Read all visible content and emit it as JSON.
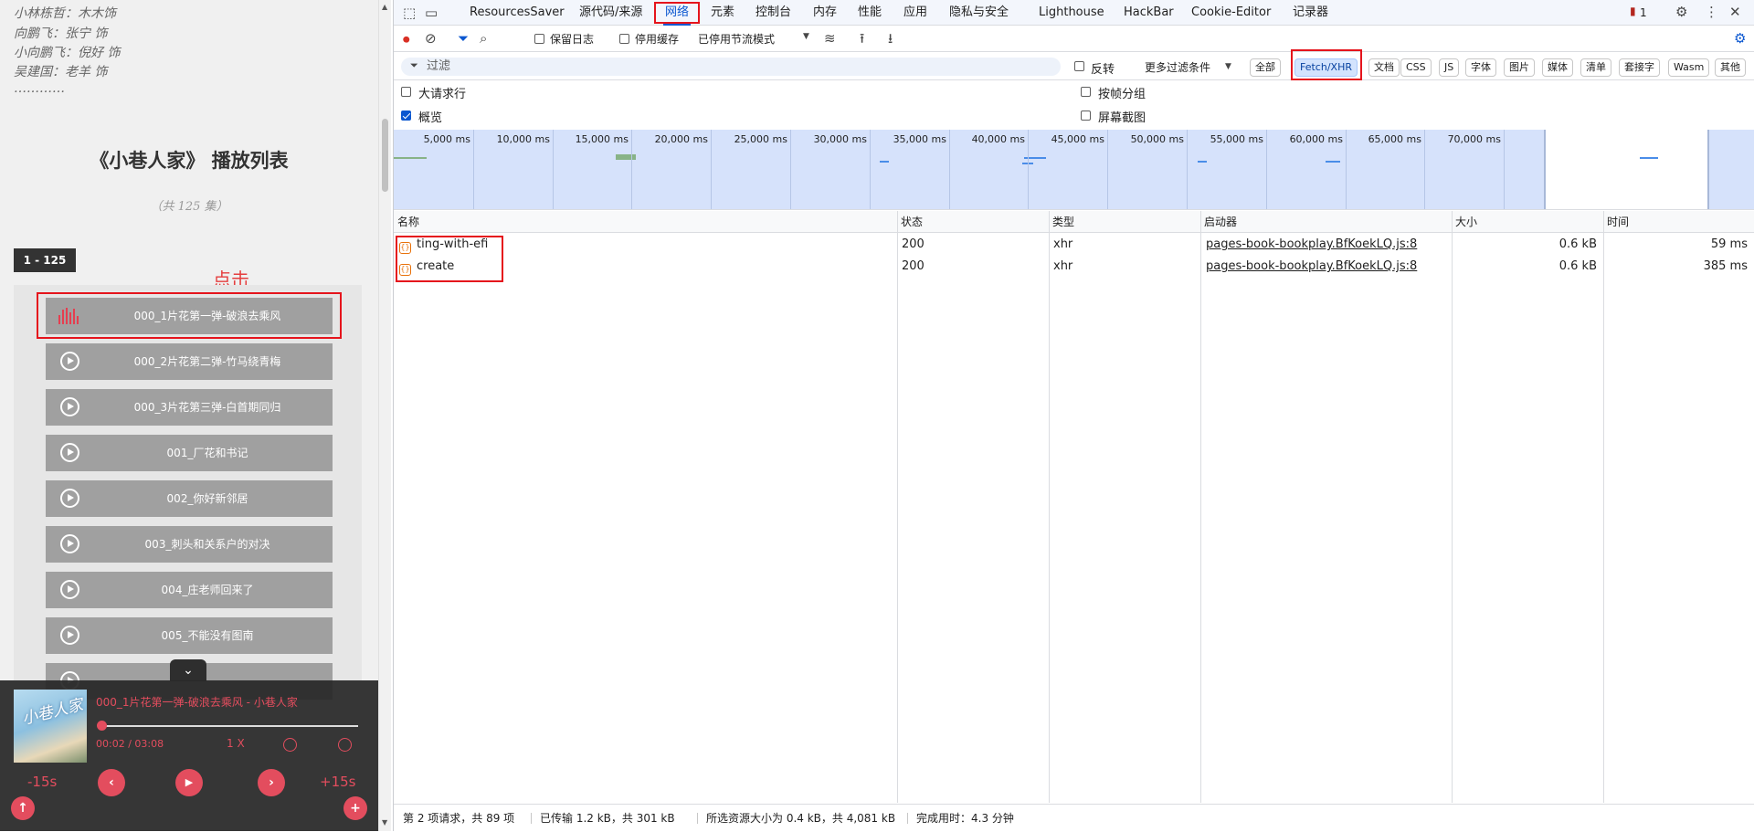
{
  "page": {
    "cast": [
      "小林栋哲：木木饰",
      "向鹏飞：张宁 饰",
      "小向鹏飞：倪好 饰",
      "吴建国：老羊 饰",
      "…………"
    ],
    "playlist_title": "《小巷人家》  播放列表",
    "episode_count": "（共 125 集）",
    "range_tab": "1 - 125",
    "click_hint": "点击",
    "episodes": [
      "000_1片花第一弹-破浪去乘风",
      "000_2片花第二弹-竹马绕青梅",
      "000_3片花第三弹-白首期同归",
      "001_厂花和书记",
      "002_你好新邻居",
      "003_刺头和关系户的对决",
      "004_庄老师回来了",
      "005_不能没有图南"
    ],
    "player": {
      "cover_text": "小巷人家",
      "now_playing": "000_1片花第一弹-破浪去乘风 - 小巷人家",
      "time": "00:02 / 03:08",
      "speed": "1 X",
      "progress_fraction": 0.01,
      "rewind": "-15s",
      "forward": "+15s"
    }
  },
  "devtools": {
    "tabs": [
      "ResourcesSaver",
      "源代码/来源",
      "网络",
      "元素",
      "控制台",
      "内存",
      "性能",
      "应用",
      "隐私与安全",
      "Lighthouse",
      "HackBar",
      "Cookie-Editor",
      "记录器"
    ],
    "active_tab": "网络",
    "issues_count": "1",
    "toolbar": {
      "preserve_log": "保留日志",
      "disable_cache": "停用缓存",
      "throttle": "已停用节流模式"
    },
    "filter": {
      "placeholder": "过滤",
      "invert": "反转",
      "more_filters": "更多过滤条件",
      "chips": [
        "全部",
        "Fetch/XHR",
        "文档",
        "CSS",
        "JS",
        "字体",
        "图片",
        "媒体",
        "清单",
        "套接字",
        "Wasm",
        "其他"
      ],
      "selected_chip": "Fetch/XHR"
    },
    "options": {
      "big_rows": "大请求行",
      "overview": "概览",
      "group_by_frame": "按帧分组",
      "screenshots": "屏幕截图"
    },
    "overview_ticks": [
      "5,000 ms",
      "10,000 ms",
      "15,000 ms",
      "20,000 ms",
      "25,000 ms",
      "30,000 ms",
      "35,000 ms",
      "40,000 ms",
      "45,000 ms",
      "50,000 ms",
      "55,000 ms",
      "60,000 ms",
      "65,000 ms",
      "70,000 ms"
    ],
    "columns": [
      "名称",
      "状态",
      "类型",
      "启动器",
      "大小",
      "时间"
    ],
    "requests": [
      {
        "name": "ting-with-efi",
        "status": "200",
        "type": "xhr",
        "initiator": "pages-book-bookplay.BfKoekLQ.js:8",
        "size": "0.6 kB",
        "time": "59 ms"
      },
      {
        "name": "create",
        "status": "200",
        "type": "xhr",
        "initiator": "pages-book-bookplay.BfKoekLQ.js:8",
        "size": "0.6 kB",
        "time": "385 ms"
      }
    ],
    "status": {
      "requests": "第 2 项请求，共 89 项",
      "transferred": "已传输 1.2 kB，共 301 kB",
      "resources": "所选资源大小为 0.4 kB，共 4,081 kB",
      "finish": "完成用时：4.3 分钟"
    },
    "colors": {
      "accent": "#0b57d0",
      "highlight": "#e5141c",
      "player": "#e34d5e"
    }
  }
}
